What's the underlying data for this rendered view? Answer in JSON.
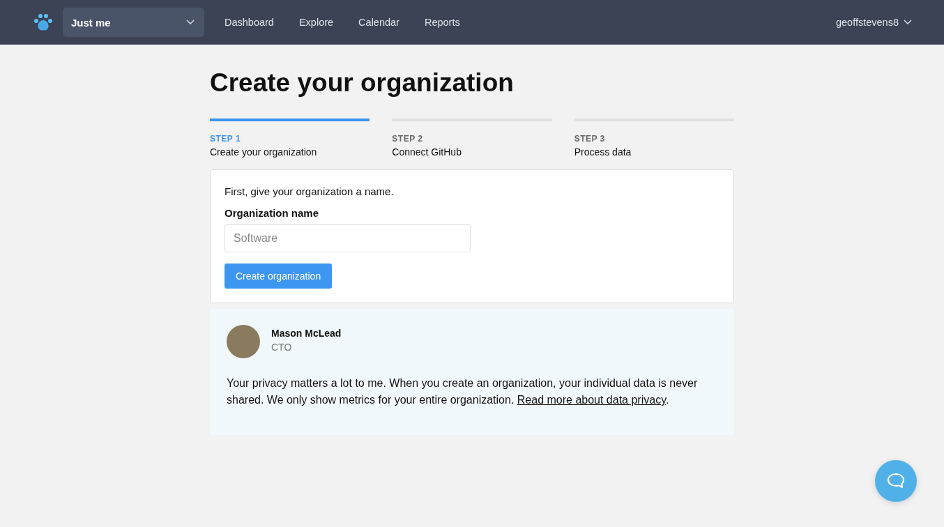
{
  "nav": {
    "workspace": "Just me",
    "links": [
      "Dashboard",
      "Explore",
      "Calendar",
      "Reports"
    ],
    "user": "geoffstevens8"
  },
  "page_title": "Create your organization",
  "steps": [
    {
      "label": "STEP 1",
      "name": "Create your organization",
      "selected": true
    },
    {
      "label": "STEP 2",
      "name": "Connect GitHub",
      "selected": false
    },
    {
      "label": "STEP 3",
      "name": "Process data",
      "selected": false
    }
  ],
  "form": {
    "intro": "First, give your organization a name.",
    "field_label": "Organization name",
    "placeholder": "Software",
    "button": "Create organization"
  },
  "note": {
    "author": "Mason McLead",
    "role": "CTO",
    "text": "Your privacy matters a lot to me. When you create an organization, your individual data is never shared. We only show metrics for your entire organization.",
    "link": "Read more about data privacy",
    "after": "."
  }
}
